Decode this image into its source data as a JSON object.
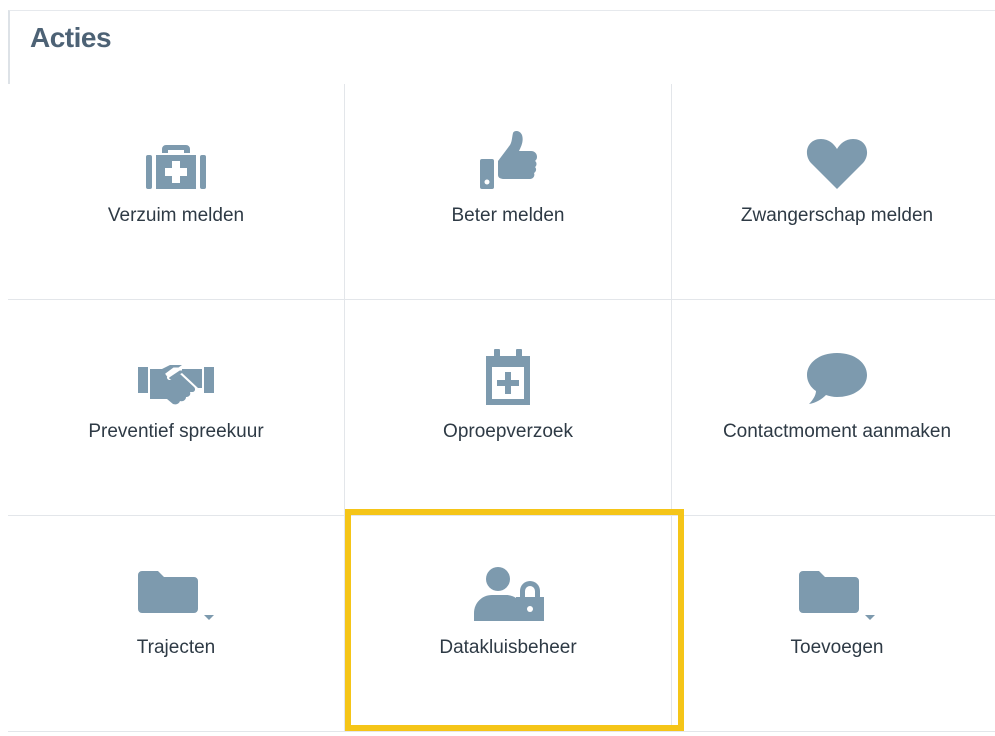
{
  "panel": {
    "title": "Acties"
  },
  "tiles": [
    {
      "label": "Verzuim melden",
      "icon": "medkit-icon"
    },
    {
      "label": "Beter melden",
      "icon": "thumbs-up-icon"
    },
    {
      "label": "Zwangerschap melden",
      "icon": "heart-icon"
    },
    {
      "label": "Preventief spreekuur",
      "icon": "handshake-icon"
    },
    {
      "label": "Oproepverzoek",
      "icon": "calendar-plus-icon"
    },
    {
      "label": "Contactmoment aanmaken",
      "icon": "speech-bubble-icon"
    },
    {
      "label": "Trajecten",
      "icon": "folder-dropdown-icon"
    },
    {
      "label": "Datakluisbeheer",
      "icon": "user-lock-icon"
    },
    {
      "label": "Toevoegen",
      "icon": "folder-dropdown-icon"
    }
  ],
  "colors": {
    "icon": "#7d9aae",
    "highlight": "#f5c518",
    "title": "#4d6275"
  }
}
